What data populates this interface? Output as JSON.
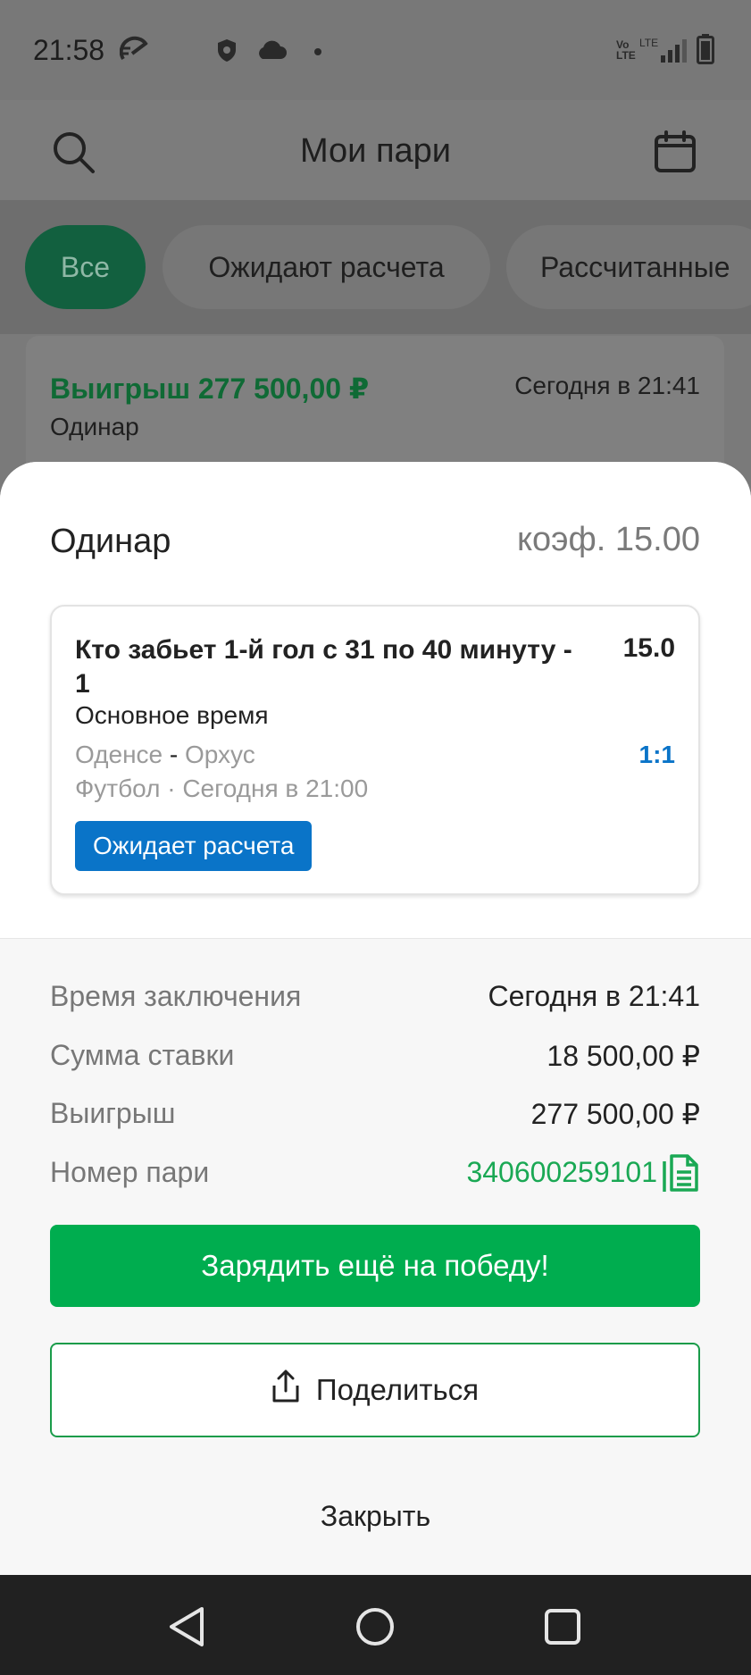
{
  "status_bar": {
    "time": "21:58",
    "icons": [
      "speed-icon",
      "shield-phone-icon",
      "cloud-icon",
      "dot-icon",
      "volte-icon",
      "lte-icon",
      "signal-icon",
      "battery-icon"
    ]
  },
  "header": {
    "title": "Мои пари",
    "search_icon": "search-icon",
    "calendar_icon": "calendar-icon"
  },
  "filters": [
    {
      "label": "Все",
      "active": true
    },
    {
      "label": "Ожидают расчета",
      "active": false
    },
    {
      "label": "Рассчитанные",
      "active": false
    }
  ],
  "background_card": {
    "win": "Выигрыш 277 500,00  ₽",
    "type": "Одинар",
    "date": "Сегодня в 21:41"
  },
  "sheet": {
    "type": "Одинар",
    "coef": "коэф. 15.00",
    "event": {
      "title": "Кто забьет 1-й гол с 31 по 40 минуту - 1",
      "coef": "15.0",
      "period": "Основное время",
      "team_home": "Оденсе",
      "team_sep": " - ",
      "team_away": "Орхус",
      "score": "1:1",
      "sport_line": "Футбол · Сегодня в 21:00",
      "status": "Ожидает расчета"
    },
    "details": [
      {
        "label": "Время заключения",
        "value": "Сегодня в 21:41"
      },
      {
        "label": "Сумма ставки",
        "value": "18 500,00 ₽"
      },
      {
        "label": "Выигрыш",
        "value": "277 500,00  ₽"
      },
      {
        "label": "Номер пари",
        "value": "340600259101"
      }
    ],
    "primary_button": "Зарядить ещё на победу!",
    "share_button": "Поделиться",
    "close_button": "Закрыть"
  },
  "colors": {
    "accent_green": "#00ad4f",
    "link_green": "#1aa854",
    "status_blue": "#0a74c8"
  }
}
